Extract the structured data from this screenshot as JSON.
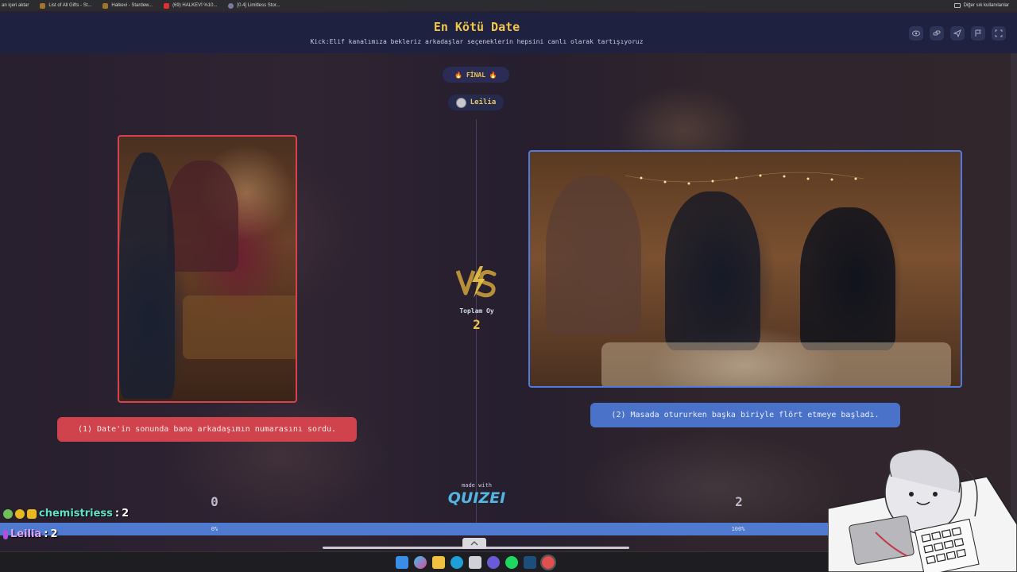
{
  "bookmarks": {
    "items": [
      {
        "label": "an içeri aktar",
        "color": "#888888"
      },
      {
        "label": "List of All Gifts - St...",
        "color": "#a0742a"
      },
      {
        "label": "Halkevi - Stardew...",
        "color": "#a0742a"
      },
      {
        "label": "(69) HALKEVİ %10...",
        "color": "#e03030"
      },
      {
        "label": "[0.4] Limitless Stor...",
        "color": "#7a7aa0"
      }
    ],
    "other": "Diğer sık kullanılanlar"
  },
  "header": {
    "title": "En Kötü Date",
    "subtitle": "Kick:Elif kanalımıza bekleriz arkadaşlar seçeneklerin hepsini canlı olarak tartışıyoruz",
    "icons": [
      "eye-icon",
      "link-icon",
      "send-icon",
      "flag-icon",
      "fullscreen-icon"
    ]
  },
  "round": {
    "badge": "🔥 FİNAL 🔥",
    "user": "Leilia"
  },
  "choices": {
    "left": {
      "label": "(1) Date'in sonunda bana arkadaşımın numarasını sordu.",
      "votes": "0",
      "percent": "0%",
      "color": "#d0424c"
    },
    "right": {
      "label": "(2) Masada otururken başka biriyle flört etmeye başladı.",
      "votes": "2",
      "percent": "100%",
      "color": "#4a72c8"
    }
  },
  "totals": {
    "label": "Toplam Oy",
    "value": "2"
  },
  "branding": {
    "made_with": "made with",
    "logo": "QUIZEI"
  },
  "progress": {
    "right_share": 1.0
  },
  "chat": [
    {
      "user": "chemistriess",
      "count": "2",
      "color": "#5fe0c8"
    },
    {
      "user": "Leilia",
      "count": "2",
      "color": "#e0a6ff"
    }
  ],
  "taskbar": {
    "icons": [
      "windows-start-icon",
      "copilot-icon",
      "file-explorer-icon",
      "edge-icon",
      "store-icon",
      "app-icon",
      "spotify-icon",
      "steam-icon",
      "browser-icon"
    ]
  }
}
